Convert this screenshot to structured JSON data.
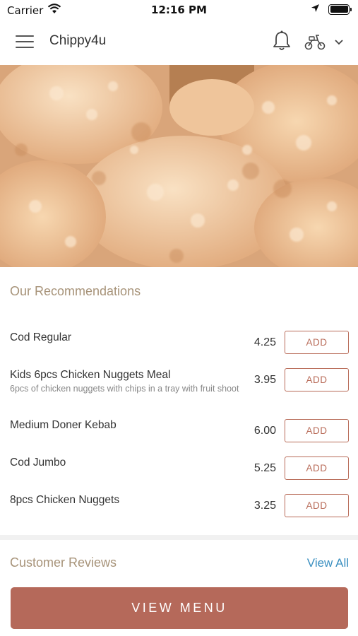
{
  "status_bar": {
    "carrier": "Carrier",
    "time": "12:16 PM",
    "icons": [
      "wifi-icon",
      "location-arrow-icon",
      "battery-icon"
    ]
  },
  "header": {
    "title": "Chippy4u",
    "icons": [
      "hamburger-menu-icon",
      "bell-icon",
      "scooter-icon",
      "chevron-down-icon"
    ]
  },
  "hero": {
    "image": "fried-chicken-photo"
  },
  "recommendations": {
    "title": "Our Recommendations",
    "items": [
      {
        "name": "Cod Regular",
        "description": "",
        "price": "4.25",
        "button": "ADD"
      },
      {
        "name": "Kids 6pcs Chicken Nuggets Meal",
        "description": "6pcs of chicken nuggets with chips in a tray with fruit shoot",
        "price": "3.95",
        "button": "ADD"
      },
      {
        "name": "Medium Doner Kebab",
        "description": "",
        "price": "6.00",
        "button": "ADD"
      },
      {
        "name": "Cod Jumbo",
        "description": "",
        "price": "5.25",
        "button": "ADD"
      },
      {
        "name": "8pcs Chicken Nuggets",
        "description": "",
        "price": "3.25",
        "button": "ADD"
      }
    ]
  },
  "reviews": {
    "title": "Customer Reviews",
    "view_all": "View All"
  },
  "cta": {
    "label": "VIEW MENU"
  },
  "colors": {
    "accent": "#b5695a",
    "section_title": "#a79379",
    "link": "#3a8fc0"
  }
}
